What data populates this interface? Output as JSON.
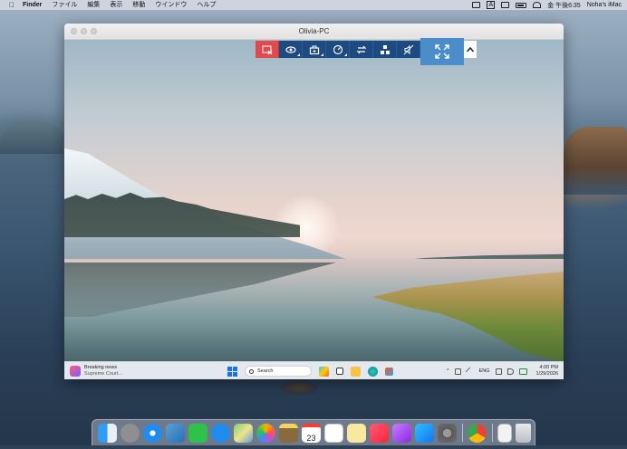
{
  "menubar": {
    "app_name": "Finder",
    "menus": [
      "ファイル",
      "編集",
      "表示",
      "移動",
      "ウインドウ",
      "ヘルプ"
    ],
    "input_source": "A",
    "clock": "金 午後6:35",
    "user": "Noha's iMac"
  },
  "window": {
    "title": "Olivia-PC"
  },
  "remote_toolbar": {
    "buttons": [
      {
        "name": "disconnect",
        "icon": "disconnect-icon",
        "color": "#e04a4f"
      },
      {
        "name": "view",
        "icon": "eye-icon"
      },
      {
        "name": "toolbox",
        "icon": "toolbox-icon"
      },
      {
        "name": "quality",
        "icon": "gauge-icon"
      },
      {
        "name": "transfer",
        "icon": "transfer-icon"
      },
      {
        "name": "apps",
        "icon": "apps-icon"
      },
      {
        "name": "mute",
        "icon": "mute-icon"
      },
      {
        "name": "fullscreen",
        "icon": "fullscreen-icon",
        "color": "#4c8cc9"
      },
      {
        "name": "collapse",
        "icon": "chevron-up-icon"
      }
    ]
  },
  "remote_taskbar": {
    "news_title": "Breaking news",
    "news_subtitle": "Supreme Court...",
    "search_placeholder": "Search",
    "language": "ENG",
    "time": "4:00 PM",
    "date": "1/29/2026"
  },
  "dock": {
    "apps": [
      "Finder",
      "Launchpad",
      "Safari",
      "Preview",
      "FaceTime",
      "Messages",
      "Maps",
      "Photos",
      "Notes",
      "Calendar",
      "Reminders",
      "Stickies",
      "Music",
      "Podcasts",
      "App Store",
      "System Preferences",
      "Chrome",
      "Document",
      "Trash"
    ],
    "calendar_day": "23"
  },
  "colors": {
    "toolbar_blue": "#1d4a80",
    "fullscreen_blue": "#4c8cc9",
    "disconnect_red": "#e04a4f"
  }
}
